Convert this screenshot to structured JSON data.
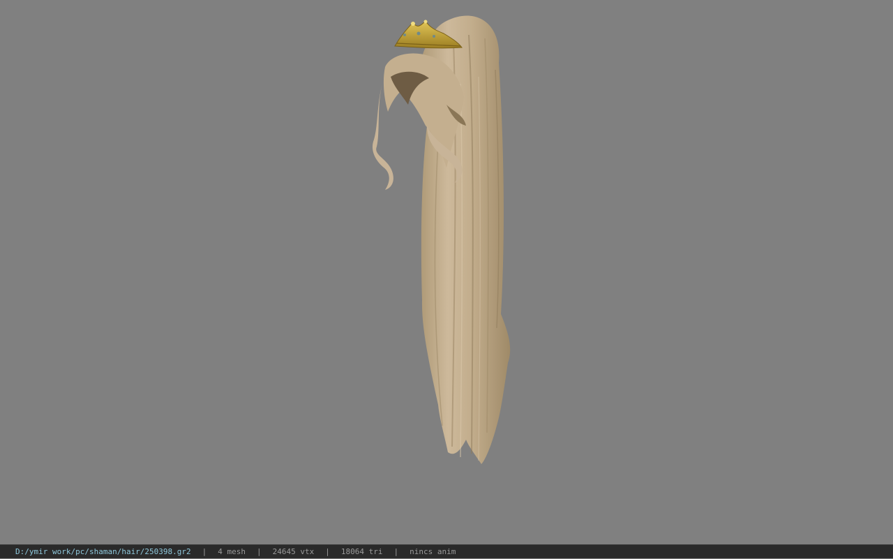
{
  "status_bar": {
    "file_path": "D:/ymir work/pc/shaman/hair/250398.gr2",
    "separator": "|",
    "mesh_count": "4 mesh",
    "vertex_count": "24645 vtx",
    "triangle_count": "18064 tri",
    "animation": "nincs anim"
  },
  "colors": {
    "background": "#808080",
    "hair": "#c8b498",
    "tiara": "#c9a83a",
    "status_bar": "#2a2a2a",
    "path_text": "#8fc8dc"
  }
}
